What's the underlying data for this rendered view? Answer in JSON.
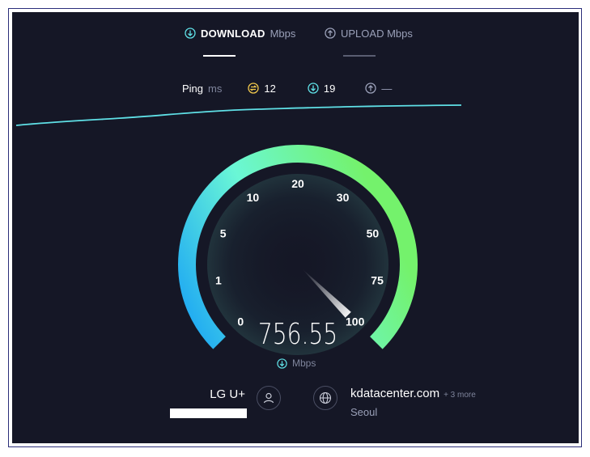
{
  "tabs": {
    "download": {
      "label": "DOWNLOAD",
      "unit": "Mbps",
      "active": true
    },
    "upload": {
      "label": "UPLOAD Mbps",
      "active": false
    }
  },
  "ping": {
    "label": "Ping",
    "unit": "ms",
    "idle": "12",
    "download": "19",
    "upload": "—"
  },
  "gauge": {
    "scale_labels": [
      "0",
      "1",
      "5",
      "10",
      "20",
      "30",
      "50",
      "75",
      "100"
    ],
    "scale_values": [
      0,
      1,
      5,
      10,
      20,
      30,
      50,
      75,
      100
    ],
    "current_speed": "756.55",
    "unit": "Mbps",
    "needle_value": 100,
    "gradient_start": "#19a3f5",
    "gradient_mid": "#6af7d6",
    "gradient_end": "#74f26c"
  },
  "connection": {
    "isp": "LG U+",
    "server": "kdatacenter.com",
    "server_more": "+ 3 more",
    "city": "Seoul"
  },
  "colors": {
    "background": "#151726",
    "accent": "#5fe0e6",
    "ping_idle": "#f2c94c"
  }
}
